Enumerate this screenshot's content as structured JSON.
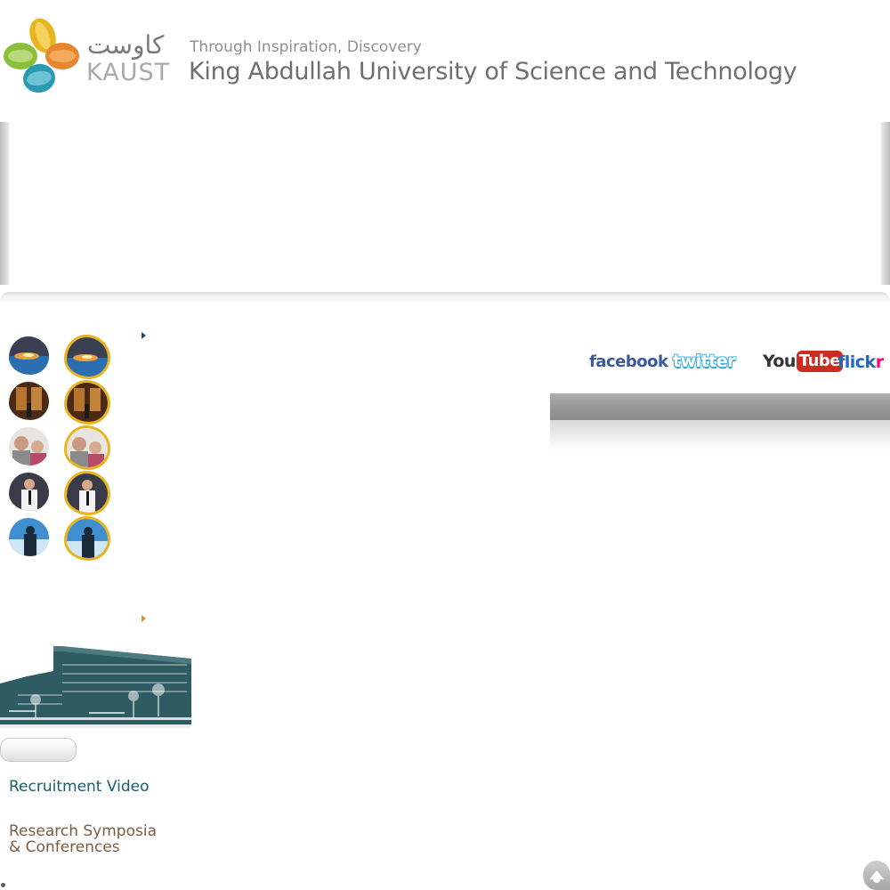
{
  "header": {
    "logo_arabic": "كاوست",
    "logo_text": "KAUST",
    "tagline": "Through Inspiration, Discovery",
    "university_name": "King Abdullah University of Science and Technology"
  },
  "social": {
    "facebook": "facebook",
    "twitter": "twitter",
    "youtube_you": "You",
    "youtube_tube": "Tube",
    "flickr_a": "flick",
    "flickr_b": "r"
  },
  "links": {
    "recruitment_video": "Recruitment Video",
    "research_line1": "Research Symposia",
    "research_line2": "& Conferences"
  },
  "colors": {
    "logo_yellow": "#e8b51e",
    "logo_orange": "#e8862f",
    "logo_green": "#8bbf3c",
    "logo_teal": "#2a9ab3",
    "highlight_border": "#e8b51e",
    "link_teal": "#195e6c",
    "link_brown": "#7a5d44",
    "facebook": "#3b5998",
    "youtube_red": "#cc2b20",
    "flickr_blue": "#2a64b5",
    "flickr_pink": "#ff0084"
  },
  "thumbnails": [
    {
      "subject": "welding-workshop-photo"
    },
    {
      "subject": "lecture-hall-photo"
    },
    {
      "subject": "researchers-photo"
    },
    {
      "subject": "speaker-photo"
    },
    {
      "subject": "ocean-diver-photo"
    }
  ]
}
